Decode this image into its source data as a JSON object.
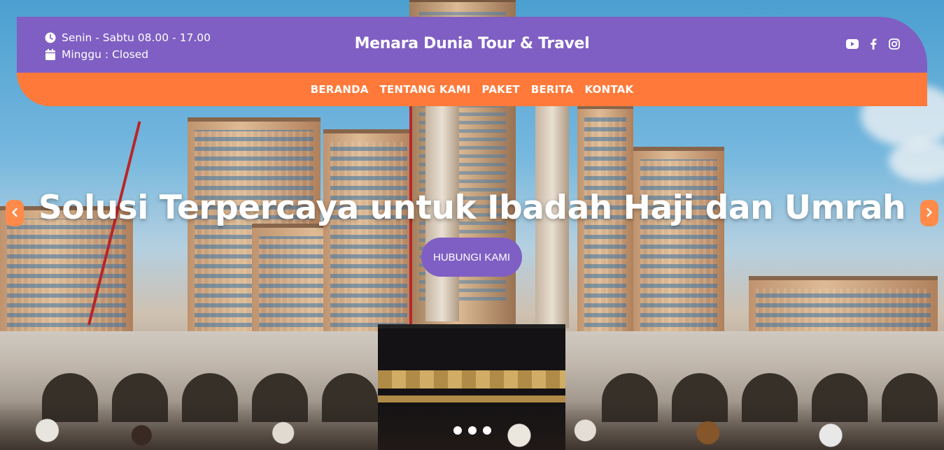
{
  "header": {
    "hours": {
      "weekday": "Senin - Sabtu 08.00 - 17.00",
      "sunday": "Minggu : Closed",
      "weekday_icon": "clock-icon",
      "sunday_icon": "calendar-icon"
    },
    "brand": "Menara Dunia Tour & Travel",
    "socials": [
      "youtube-icon",
      "facebook-icon",
      "instagram-icon"
    ],
    "colors": {
      "top_bar": "#7f5fc3",
      "nav_bar": "#ff7a3a"
    }
  },
  "nav": {
    "items": [
      {
        "label": "BERANDA"
      },
      {
        "label": "TENTANG KAMI"
      },
      {
        "label": "PAKET"
      },
      {
        "label": "BERITA"
      },
      {
        "label": "KONTAK"
      }
    ]
  },
  "hero": {
    "headline": "Solusi Terpercaya untuk Ibadah Haji dan Umrah",
    "cta_label": "HUBUNGI KAMI",
    "prev_icon": "chevron-left-icon",
    "next_icon": "chevron-right-icon",
    "slide_count": 3,
    "colors": {
      "cta": "#7f5fc3",
      "arrows": "#ff8a4a"
    }
  }
}
